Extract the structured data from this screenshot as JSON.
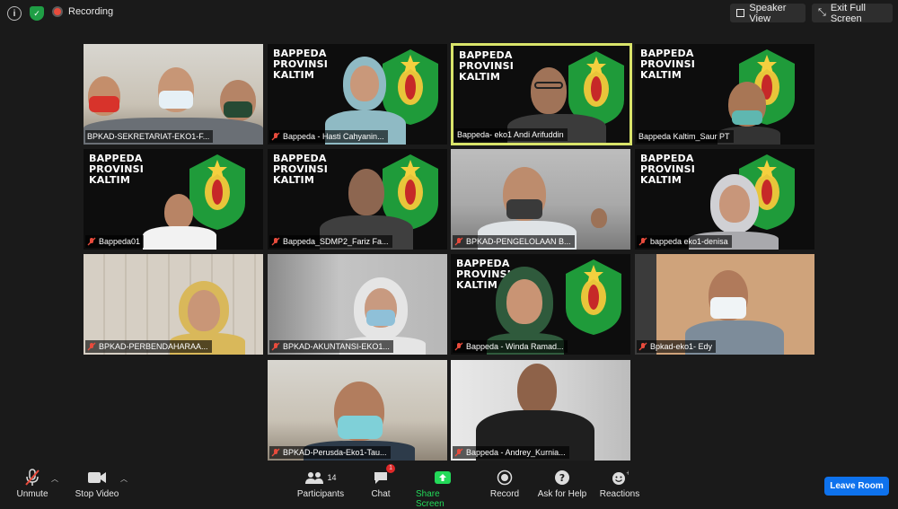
{
  "topbar": {
    "info_icon": "info-icon",
    "security_icon": "shield-check-icon",
    "recording_label": "Recording",
    "speaker_view_label": "Speaker View",
    "exit_fullscreen_label": "Exit Full Screen"
  },
  "colors": {
    "background": "#1a1a1a",
    "active_speaker_border": "#d9e46a",
    "leave_button": "#0e72ed",
    "share_screen": "#23d959",
    "muted_mic": "#e84b3c"
  },
  "banner": {
    "line1": "BAPPEDA",
    "line2": "PROVINSI",
    "line3": "KALTIM"
  },
  "tiles": [
    {
      "name": "BPKAD-SEKRETARIAT-EKO1-F..."
    },
    {
      "name": "Bappeda - Hasti Cahyanin..."
    },
    {
      "name": "Bappeda- eko1 Andi Arifuddin"
    },
    {
      "name": "Bappeda Kaltim_Saur PT"
    },
    {
      "name": "Bappeda01"
    },
    {
      "name": "Bappeda_SDMP2_Fariz Fa..."
    },
    {
      "name": "BPKAD-PENGELOLAAN B..."
    },
    {
      "name": "bappeda eko1-denisa"
    },
    {
      "name": "BPKAD-PERBENDAHARAA..."
    },
    {
      "name": "BPKAD-AKUNTANSI-EKO1..."
    },
    {
      "name": "Bappeda - Winda Ramad..."
    },
    {
      "name": "Bpkad-eko1- Edy"
    },
    {
      "name": "BPKAD-Perusda-Eko1-Tau..."
    },
    {
      "name": "Bappeda - Andrey_Kurnia..."
    }
  ],
  "toolbar": {
    "unmute": "Unmute",
    "stop_video": "Stop Video",
    "participants": "Participants",
    "participants_count": "14",
    "chat": "Chat",
    "chat_badge": "1",
    "share_screen": "Share Screen",
    "record": "Record",
    "ask_for_help": "Ask for Help",
    "reactions": "Reactions",
    "leave_room": "Leave Room"
  }
}
